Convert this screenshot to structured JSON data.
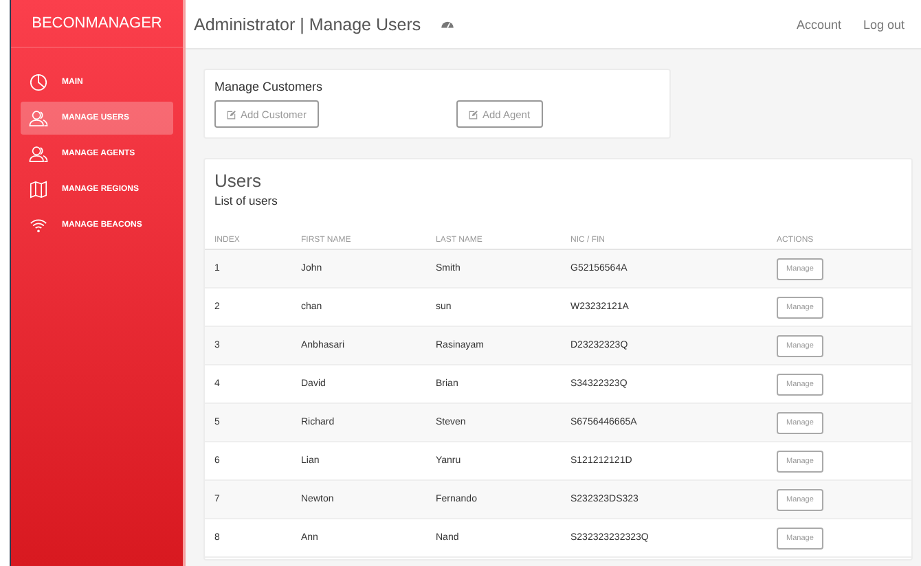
{
  "brand": "BECONMANAGER",
  "header": {
    "title": "Administrator | Manage Users",
    "links": [
      "Account",
      "Log out"
    ]
  },
  "sidebar": {
    "items": [
      {
        "label": "MAIN",
        "selected": false
      },
      {
        "label": "MANAGE USERS",
        "selected": true
      },
      {
        "label": "MANAGE AGENTS",
        "selected": false
      },
      {
        "label": "MANAGE REGIONS",
        "selected": false
      },
      {
        "label": "MANAGE BEACONS",
        "selected": false
      }
    ]
  },
  "customers": {
    "title": "Manage Customers",
    "buttons": [
      "Add Customer",
      "Add Agent"
    ]
  },
  "users": {
    "title": "Users",
    "subtitle": "List of users",
    "columns": [
      "INDEX",
      "FIRST NAME",
      "LAST NAME",
      "NIC / FIN",
      "ACTIONS"
    ],
    "rows": [
      [
        "1",
        "John",
        "Smith",
        "G52156564A",
        "Manage"
      ],
      [
        "2",
        "chan",
        "sun",
        "W23232121A",
        "Manage"
      ],
      [
        "3",
        "Anbhasari",
        "Rasinayam",
        "D23232323Q",
        "Manage"
      ],
      [
        "4",
        "David",
        "Brian",
        "S34322323Q",
        "Manage"
      ],
      [
        "5",
        "Richard",
        "Steven",
        "S6756446665A",
        "Manage"
      ],
      [
        "6",
        "Lian",
        "Yanru",
        "S121212121D",
        "Manage"
      ],
      [
        "7",
        "Newton",
        "Fernando",
        "S232323DS323",
        "Manage"
      ],
      [
        "8",
        "Ann",
        "Nand",
        "S232323232323Q",
        "Manage"
      ]
    ]
  }
}
